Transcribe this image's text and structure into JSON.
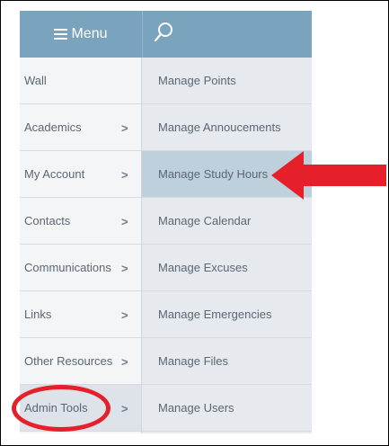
{
  "header": {
    "menu_label": "Menu",
    "menu_icon": "hamburger-icon",
    "search_icon": "search-icon"
  },
  "sidebar": {
    "items": [
      {
        "label": "Wall",
        "has_chevron": false
      },
      {
        "label": "Academics",
        "has_chevron": true
      },
      {
        "label": "My Account",
        "has_chevron": true
      },
      {
        "label": "Contacts",
        "has_chevron": true
      },
      {
        "label": "Communications",
        "has_chevron": true
      },
      {
        "label": "Links",
        "has_chevron": true
      },
      {
        "label": "Other Resources",
        "has_chevron": true
      },
      {
        "label": "Admin Tools",
        "has_chevron": true,
        "active": true
      }
    ],
    "chevron": ">"
  },
  "submenu": {
    "items": [
      {
        "label": "Manage Points"
      },
      {
        "label": "Manage Annoucements"
      },
      {
        "label": "Manage Study Hours",
        "highlighted": true
      },
      {
        "label": "Manage Calendar"
      },
      {
        "label": "Manage Excuses"
      },
      {
        "label": "Manage Emergencies"
      },
      {
        "label": "Manage Files"
      },
      {
        "label": "Manage Users"
      }
    ]
  },
  "annotations": {
    "color": "#e5202a",
    "arrow_target": "Manage Study Hours",
    "circle_target": "Admin Tools"
  },
  "colors": {
    "header_bg": "#7aa3bd",
    "left_bg": "#f3f5f7",
    "right_bg": "#e6eaee",
    "highlight_bg": "#bdd0dc"
  }
}
